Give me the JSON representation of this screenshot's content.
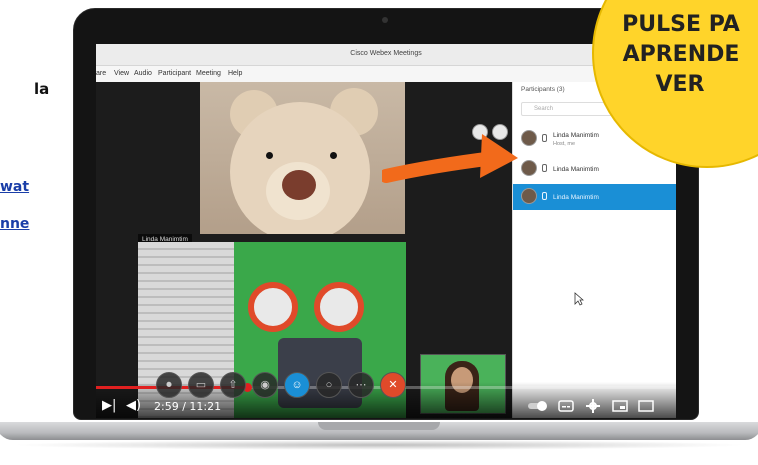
{
  "side_text": {
    "line1": "la",
    "link1": "wat",
    "link2": "nne"
  },
  "window": {
    "title": "Cisco Webex Meetings",
    "menu": [
      "are",
      "View",
      "Audio",
      "Participant",
      "Meeting",
      "Help"
    ]
  },
  "video": {
    "top_label": "Linda Manimtim",
    "bottom_label": "Linda Ma"
  },
  "participants_panel": {
    "header": "Participants (3)",
    "search_placeholder": "Search",
    "items": [
      {
        "name": "Linda Manimtim",
        "sub": "Host, me",
        "active": false
      },
      {
        "name": "Linda Manimtim",
        "sub": "",
        "active": false
      },
      {
        "name": "Linda Manimtim",
        "sub": "",
        "active": true
      }
    ]
  },
  "player": {
    "time": "2:59 / 11:21",
    "progress": 0.26,
    "accent": "#e02020"
  },
  "badge": {
    "lines": [
      "PULSE PA",
      "APRENDE",
      "VER"
    ],
    "color": "#ffd42a"
  },
  "colors": {
    "active_row": "#1a8fd6",
    "arrow": "#f26a1b"
  }
}
